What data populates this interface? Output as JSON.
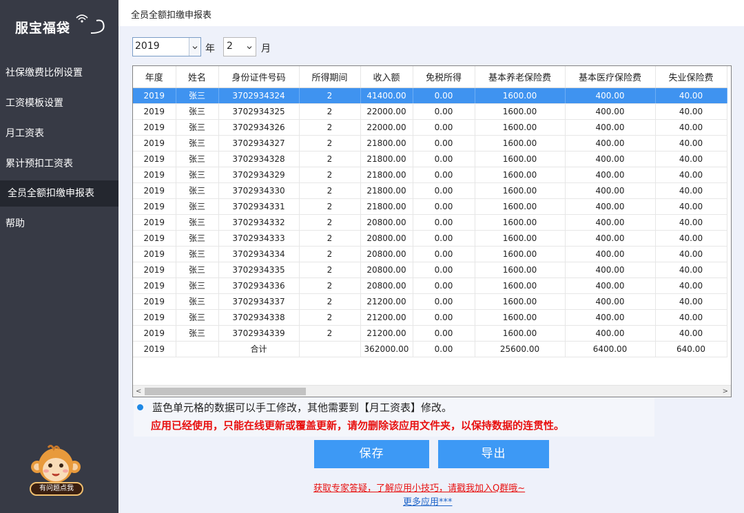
{
  "sidebar": {
    "logo_text": "服宝福袋",
    "items": [
      {
        "label": "社保缴费比例设置"
      },
      {
        "label": "工资模板设置"
      },
      {
        "label": "月工资表"
      },
      {
        "label": "累计预扣工资表"
      },
      {
        "label": "全员全额扣缴申报表"
      },
      {
        "label": "帮助"
      }
    ],
    "active_index": 4,
    "mascot_label": "有问题点我"
  },
  "header": {
    "title": "全员全额扣缴申报表"
  },
  "filters": {
    "year": "2019",
    "year_unit": "年",
    "month": "2",
    "month_unit": "月"
  },
  "table": {
    "columns": [
      "年度",
      "姓名",
      "身份证件号码",
      "所得期间",
      "收入额",
      "免税所得",
      "基本养老保险费",
      "基本医疗保险费",
      "失业保险费"
    ],
    "rows": [
      [
        "2019",
        "张三",
        "3702934324",
        "2",
        "41400.00",
        "0.00",
        "1600.00",
        "400.00",
        "40.00"
      ],
      [
        "2019",
        "张三",
        "3702934325",
        "2",
        "22000.00",
        "0.00",
        "1600.00",
        "400.00",
        "40.00"
      ],
      [
        "2019",
        "张三",
        "3702934326",
        "2",
        "22000.00",
        "0.00",
        "1600.00",
        "400.00",
        "40.00"
      ],
      [
        "2019",
        "张三",
        "3702934327",
        "2",
        "21800.00",
        "0.00",
        "1600.00",
        "400.00",
        "40.00"
      ],
      [
        "2019",
        "张三",
        "3702934328",
        "2",
        "21800.00",
        "0.00",
        "1600.00",
        "400.00",
        "40.00"
      ],
      [
        "2019",
        "张三",
        "3702934329",
        "2",
        "21800.00",
        "0.00",
        "1600.00",
        "400.00",
        "40.00"
      ],
      [
        "2019",
        "张三",
        "3702934330",
        "2",
        "21800.00",
        "0.00",
        "1600.00",
        "400.00",
        "40.00"
      ],
      [
        "2019",
        "张三",
        "3702934331",
        "2",
        "21800.00",
        "0.00",
        "1600.00",
        "400.00",
        "40.00"
      ],
      [
        "2019",
        "张三",
        "3702934332",
        "2",
        "20800.00",
        "0.00",
        "1600.00",
        "400.00",
        "40.00"
      ],
      [
        "2019",
        "张三",
        "3702934333",
        "2",
        "20800.00",
        "0.00",
        "1600.00",
        "400.00",
        "40.00"
      ],
      [
        "2019",
        "张三",
        "3702934334",
        "2",
        "20800.00",
        "0.00",
        "1600.00",
        "400.00",
        "40.00"
      ],
      [
        "2019",
        "张三",
        "3702934335",
        "2",
        "20800.00",
        "0.00",
        "1600.00",
        "400.00",
        "40.00"
      ],
      [
        "2019",
        "张三",
        "3702934336",
        "2",
        "20800.00",
        "0.00",
        "1600.00",
        "400.00",
        "40.00"
      ],
      [
        "2019",
        "张三",
        "3702934337",
        "2",
        "21200.00",
        "0.00",
        "1600.00",
        "400.00",
        "40.00"
      ],
      [
        "2019",
        "张三",
        "3702934338",
        "2",
        "21200.00",
        "0.00",
        "1600.00",
        "400.00",
        "40.00"
      ],
      [
        "2019",
        "张三",
        "3702934339",
        "2",
        "21200.00",
        "0.00",
        "1600.00",
        "400.00",
        "40.00"
      ],
      [
        "2019",
        "",
        "合计",
        "",
        "362000.00",
        "0.00",
        "25600.00",
        "6400.00",
        "640.00"
      ]
    ],
    "selected_row": 0,
    "selection_color": "#3f93f0"
  },
  "notes": {
    "line1": "蓝色单元格的数据可以手工修改，其他需要到【月工资表】修改。",
    "line2": "应用已经使用，只能在线更新或覆盖更新，请勿删除该应用文件夹，以保持数据的连贯性。"
  },
  "buttons": {
    "save": "保存",
    "export": "导出"
  },
  "links": {
    "help_link": "获取专家答疑，了解应用小技巧，请戳我加入Q群哦~",
    "more_apps": "更多应用***"
  },
  "colors": {
    "sidebar_bg": "#373a45",
    "accent": "#3d99f5",
    "warning": "#e8100f"
  }
}
